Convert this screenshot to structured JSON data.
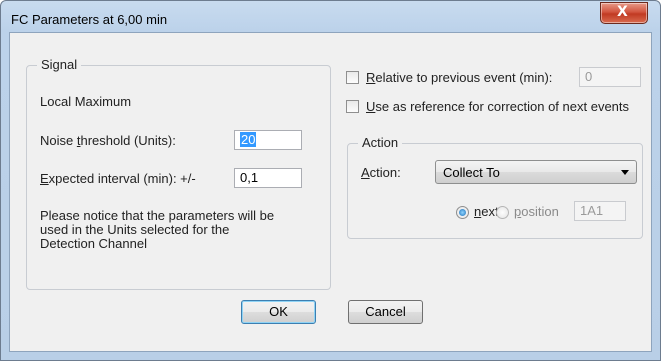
{
  "window": {
    "title": "FC Parameters at 6,00 min",
    "close_label": "X"
  },
  "signal": {
    "legend": "Signal",
    "heading": "Local Maximum",
    "noise_label_pre": "Noise ",
    "noise_label_hot": "t",
    "noise_label_post": "hreshold (Units):",
    "noise_value": "20",
    "interval_label_hot": "E",
    "interval_label_post": "xpected interval (min): +/-",
    "interval_value": "0,1",
    "note": "Please notice that the parameters will be used in the Units selected for the Detection Channel"
  },
  "options": {
    "relative_hot": "R",
    "relative_post": "elative to previous event (min):",
    "relative_value": "0",
    "reference_hot": "U",
    "reference_post": "se as reference for correction of next events"
  },
  "action": {
    "legend": "Action",
    "label_hot": "A",
    "label_post": "ction:",
    "selected": "Collect To",
    "next_hot": "n",
    "next_post": "ext",
    "position_hot": "p",
    "position_post": "osition",
    "position_value": "1A1"
  },
  "buttons": {
    "ok": "OK",
    "cancel": "Cancel"
  }
}
